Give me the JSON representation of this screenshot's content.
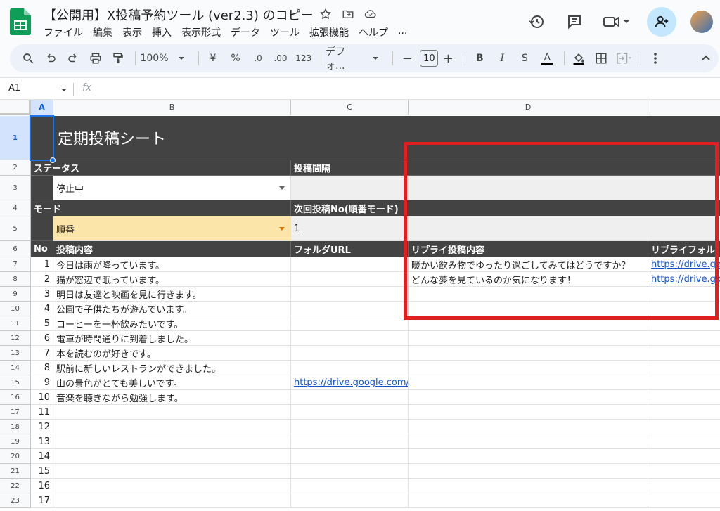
{
  "app": {
    "title": "【公開用】X投稿予約ツール (ver2.3) のコピー",
    "menu": [
      "ファイル",
      "編集",
      "表示",
      "挿入",
      "表示形式",
      "データ",
      "ツール",
      "拡張機能",
      "ヘルプ",
      "..."
    ]
  },
  "toolbar": {
    "zoom": "100%",
    "currency": "¥",
    "percent": "%",
    "dec_decrease": ".0",
    "dec_increase": ".00",
    "format_123": "123",
    "font": "デフォ...",
    "minus": "−",
    "font_size": "10",
    "plus": "+",
    "bold": "B",
    "italic": "I",
    "strike": "S",
    "text_color": "A"
  },
  "formula_bar": {
    "cell_ref": "A1",
    "fx": "fx"
  },
  "columns": [
    "A",
    "B",
    "C",
    "D",
    ""
  ],
  "rows": {
    "numbers": [
      "1",
      "2",
      "3",
      "4",
      "5",
      "6",
      "7",
      "8",
      "9",
      "10",
      "11",
      "12",
      "13",
      "14",
      "15",
      "16",
      "17",
      "18",
      "19",
      "20",
      "21",
      "22",
      "23"
    ]
  },
  "sheet": {
    "title": "定期投稿シート",
    "status_label": "ステータス",
    "status_value": "停止中",
    "interval_label": "投稿間隔",
    "mode_label": "モード",
    "mode_value": "順番",
    "next_label": "次回投稿No(順番モード)",
    "next_value": "1",
    "table_headers": {
      "no": "No",
      "content": "投稿内容",
      "folder": "フォルダURL",
      "reply": "リプライ投稿内容",
      "reply_folder": "リプライフォル"
    },
    "posts": [
      {
        "no": "1",
        "content": "今日は雨が降っています。",
        "folder": "",
        "reply": "暖かい飲み物でゆったり過ごしてみてはどうですか？",
        "reply_folder": "https://drive.go"
      },
      {
        "no": "2",
        "content": "猫が窓辺で眠っています。",
        "folder": "",
        "reply": "どんな夢を見ているのか気になります！",
        "reply_folder": "https://drive.go"
      },
      {
        "no": "3",
        "content": "明日は友達と映画を見に行きます。",
        "folder": "",
        "reply": "",
        "reply_folder": ""
      },
      {
        "no": "4",
        "content": "公園で子供たちが遊んでいます。",
        "folder": "",
        "reply": "",
        "reply_folder": ""
      },
      {
        "no": "5",
        "content": "コーヒーを一杯飲みたいです。",
        "folder": "",
        "reply": "",
        "reply_folder": ""
      },
      {
        "no": "6",
        "content": "電車が時間通りに到着しました。",
        "folder": "",
        "reply": "",
        "reply_folder": ""
      },
      {
        "no": "7",
        "content": "本を読むのが好きです。",
        "folder": "",
        "reply": "",
        "reply_folder": ""
      },
      {
        "no": "8",
        "content": "駅前に新しいレストランができました。",
        "folder": "",
        "reply": "",
        "reply_folder": ""
      },
      {
        "no": "9",
        "content": "山の景色がとても美しいです。",
        "folder": "https://drive.google.com/d",
        "reply": "",
        "reply_folder": ""
      },
      {
        "no": "10",
        "content": "音楽を聴きながら勉強します。",
        "folder": "",
        "reply": "",
        "reply_folder": ""
      },
      {
        "no": "11",
        "content": "",
        "folder": "",
        "reply": "",
        "reply_folder": ""
      },
      {
        "no": "12",
        "content": "",
        "folder": "",
        "reply": "",
        "reply_folder": ""
      },
      {
        "no": "13",
        "content": "",
        "folder": "",
        "reply": "",
        "reply_folder": ""
      },
      {
        "no": "14",
        "content": "",
        "folder": "",
        "reply": "",
        "reply_folder": ""
      },
      {
        "no": "15",
        "content": "",
        "folder": "",
        "reply": "",
        "reply_folder": ""
      },
      {
        "no": "16",
        "content": "",
        "folder": "",
        "reply": "",
        "reply_folder": ""
      },
      {
        "no": "17",
        "content": "",
        "folder": "",
        "reply": "",
        "reply_folder": ""
      }
    ]
  },
  "colors": {
    "dark_header": "#434343",
    "highlight_box": "#e02020",
    "link": "#1155cc",
    "mode_fill": "#fce5a8"
  }
}
